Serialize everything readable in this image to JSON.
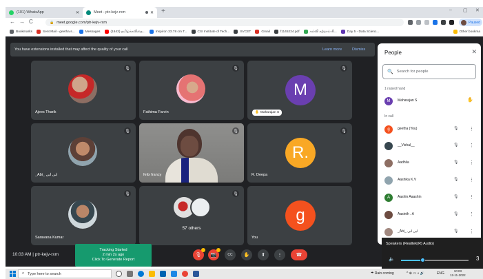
{
  "browser": {
    "tabs": [
      {
        "title": "(101) WhatsApp",
        "color": "#25d366"
      },
      {
        "title": "Meet - ptr-kejv-rxm",
        "color": "#00897b"
      }
    ],
    "new_tab": "+",
    "window_controls": [
      "–",
      "▢",
      "✕"
    ],
    "url": "meet.google.com/ptr-kejv-rxm",
    "profile_status": "Paused",
    "bookmarks": [
      {
        "label": "Bookmarks",
        "color": "#5f6368"
      },
      {
        "label": "Sent Mail - geetha.s...",
        "color": "#d93025"
      },
      {
        "label": "Messages",
        "color": "#1a73e8"
      },
      {
        "label": "(1643) தமிழ்க்கவிதை...",
        "color": "#ff0000"
      },
      {
        "label": "Inspiron 33.78 cm T...",
        "color": "#1a73e8"
      },
      {
        "label": "CSI Institute of Tech...",
        "color": "#3c4043"
      },
      {
        "label": "SVCET",
        "color": "#3c4043"
      },
      {
        "label": "Gmail",
        "color": "#d93025"
      },
      {
        "label": "f1145224.pdf",
        "color": "#3c4043"
      },
      {
        "label": "கல்வி கற்றால் கி...",
        "color": "#34a853"
      },
      {
        "label": "Day 5 - Data Scienc...",
        "color": "#5e35b1"
      }
    ],
    "other_bookmarks": "Other bookma"
  },
  "meet": {
    "banner_text": "You have extensions installed that may affect the quality of your call",
    "banner_learn_more": "Learn more",
    "banner_dismiss": "Dismiss",
    "tiles": [
      {
        "name": "Ajees Tharik",
        "kind": "photo",
        "color": "#8d6e63"
      },
      {
        "name": "Fathima Farvin",
        "kind": "photo",
        "color": "#e57373"
      },
      {
        "name": "Maharajan S",
        "kind": "letter",
        "letter": "M",
        "color": "#6a3fb0",
        "raised": true
      },
      {
        "name": "_Abi_ ابی ابی",
        "kind": "photo",
        "color": "#5d4037"
      },
      {
        "name": "felix francy",
        "kind": "video",
        "color": "#9e9e9e"
      },
      {
        "name": "R. Deepa",
        "kind": "letter",
        "letter": "R.",
        "color": "#f9a825"
      },
      {
        "name": "Saravana Kumar",
        "kind": "photo",
        "color": "#546e7a"
      },
      {
        "name": "57 others",
        "kind": "others",
        "color": "#bdbdbd"
      },
      {
        "name": "You",
        "kind": "letter",
        "letter": "g",
        "color": "#f4511e"
      }
    ],
    "time": "10:03 AM",
    "meeting_code": "ptr-kejv-rxm",
    "tracking": {
      "line1": "Tracking Started",
      "line2": "2 min 2s ago",
      "line3": "Click To Generate Report"
    },
    "controls": [
      {
        "name": "mic-off",
        "glyph": "🎙"
      },
      {
        "name": "camera-off",
        "glyph": "📷"
      },
      {
        "name": "captions",
        "glyph": "CC"
      },
      {
        "name": "raise-hand",
        "glyph": "✋"
      },
      {
        "name": "present",
        "glyph": "⬆"
      },
      {
        "name": "more",
        "glyph": "⋮"
      },
      {
        "name": "end-call",
        "glyph": "☎"
      }
    ]
  },
  "people": {
    "title": "People",
    "search_placeholder": "Search for people",
    "raised_label": "1 raised hand",
    "raised": [
      {
        "name": "Maharajan S",
        "initial": "M",
        "color": "#6a3fb0"
      }
    ],
    "incall_label": "In call",
    "incall": [
      {
        "name": "geetha (You)",
        "initial": "g",
        "color": "#f4511e"
      },
      {
        "name": "__Vishal__",
        "initial": "",
        "color": "#37474f"
      },
      {
        "name": "Aadhila",
        "initial": "",
        "color": "#8d6e63"
      },
      {
        "name": "Aashika K.V",
        "initial": "",
        "color": "#90a4ae"
      },
      {
        "name": "Aashin Aaashin",
        "initial": "A",
        "color": "#2e7d32"
      },
      {
        "name": "Aasinth . A",
        "initial": "",
        "color": "#6d4c41"
      },
      {
        "name": "_Abi_ ابی ابی",
        "initial": "",
        "color": "#a1887f"
      }
    ]
  },
  "volume": {
    "title": "Speakers (Realtek(R) Audio)",
    "level": 33,
    "level_label": "3"
  },
  "taskbar": {
    "search_placeholder": "Type here to search",
    "weather": "Rain coming",
    "lang": "ENG",
    "time": "10:03",
    "date": "12-11-2022"
  }
}
